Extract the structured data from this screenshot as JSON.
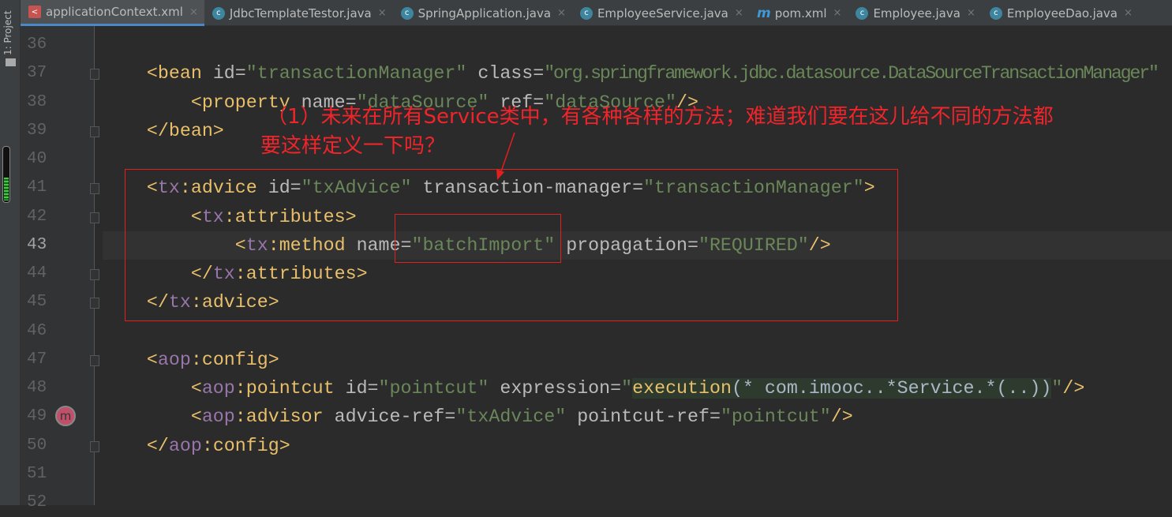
{
  "sidebar": {
    "project_label": "1: Project"
  },
  "tabs": [
    {
      "label": "applicationContext.xml",
      "icon": "xml-file-icon",
      "active": true
    },
    {
      "label": "JdbcTemplateTestor.java",
      "icon": "java-class-icon"
    },
    {
      "label": "SpringApplication.java",
      "icon": "java-class-icon"
    },
    {
      "label": "EmployeeService.java",
      "icon": "java-class-icon"
    },
    {
      "label": "pom.xml",
      "icon": "maven-icon"
    },
    {
      "label": "Employee.java",
      "icon": "java-class-icon"
    },
    {
      "label": "EmployeeDao.java",
      "icon": "java-class-icon"
    }
  ],
  "editor": {
    "current_line": "43",
    "lines": [
      {
        "n": "36",
        "tokens": []
      },
      {
        "n": "37",
        "tokens": [
          [
            "    ",
            "p"
          ],
          [
            "<bean ",
            "t"
          ],
          [
            "id=",
            "a"
          ],
          [
            "\"transactionManager\" ",
            "v"
          ],
          [
            "class=",
            "a"
          ],
          [
            "\"org.springframework.jdbc.datasource.DataSourceTransactionManager\"",
            "v"
          ]
        ]
      },
      {
        "n": "38",
        "tokens": [
          [
            "        ",
            "p"
          ],
          [
            "<property ",
            "t"
          ],
          [
            "name=",
            "a"
          ],
          [
            "\"dataSource\" ",
            "v"
          ],
          [
            "ref=",
            "a"
          ],
          [
            "\"dataSource\"",
            "v"
          ],
          [
            "/>",
            "t"
          ]
        ]
      },
      {
        "n": "39",
        "tokens": [
          [
            "    ",
            "p"
          ],
          [
            "</bean>",
            "t"
          ]
        ]
      },
      {
        "n": "40",
        "tokens": []
      },
      {
        "n": "41",
        "tokens": [
          [
            "    ",
            "p"
          ],
          [
            "<",
            "t"
          ],
          [
            "tx",
            "ns"
          ],
          [
            ":advice ",
            "t"
          ],
          [
            "id=",
            "a"
          ],
          [
            "\"txAdvice\" ",
            "v"
          ],
          [
            "transaction-manager=",
            "a"
          ],
          [
            "\"transactionManager\"",
            "v"
          ],
          [
            ">",
            "t"
          ]
        ]
      },
      {
        "n": "42",
        "tokens": [
          [
            "        ",
            "p"
          ],
          [
            "<",
            "t"
          ],
          [
            "tx",
            "ns"
          ],
          [
            ":attributes>",
            "t"
          ]
        ]
      },
      {
        "n": "43",
        "tokens": [
          [
            "            ",
            "p"
          ],
          [
            "<",
            "t"
          ],
          [
            "tx",
            "ns"
          ],
          [
            ":method ",
            "t"
          ],
          [
            "name=",
            "a"
          ],
          [
            "\"batchImport\" ",
            "v"
          ],
          [
            "propagation=",
            "a"
          ],
          [
            "\"REQUIRED\"",
            "v"
          ],
          [
            "/>",
            "t"
          ]
        ]
      },
      {
        "n": "44",
        "tokens": [
          [
            "        ",
            "p"
          ],
          [
            "</",
            "t"
          ],
          [
            "tx",
            "ns"
          ],
          [
            ":attributes>",
            "t"
          ]
        ]
      },
      {
        "n": "45",
        "tokens": [
          [
            "    ",
            "p"
          ],
          [
            "</",
            "t"
          ],
          [
            "tx",
            "ns"
          ],
          [
            ":advice>",
            "t"
          ]
        ]
      },
      {
        "n": "46",
        "tokens": []
      },
      {
        "n": "47",
        "tokens": [
          [
            "    ",
            "p"
          ],
          [
            "<",
            "t"
          ],
          [
            "aop",
            "ns"
          ],
          [
            ":config>",
            "t"
          ]
        ]
      },
      {
        "n": "48",
        "tokens": [
          [
            "        ",
            "p"
          ],
          [
            "<",
            "t"
          ],
          [
            "aop",
            "ns"
          ],
          [
            ":pointcut ",
            "t"
          ],
          [
            "id=",
            "a"
          ],
          [
            "\"pointcut\" ",
            "v"
          ],
          [
            "expression=",
            "a"
          ],
          [
            "\"",
            "v"
          ],
          [
            "execution",
            "t inj"
          ],
          [
            "(* com.imooc..*Service.*(..))",
            "p inj"
          ],
          [
            "\"",
            "v"
          ],
          [
            "/>",
            "t"
          ]
        ]
      },
      {
        "n": "49",
        "tokens": [
          [
            "        ",
            "p"
          ],
          [
            "<",
            "t"
          ],
          [
            "aop",
            "ns"
          ],
          [
            ":advisor ",
            "t"
          ],
          [
            "advice-ref=",
            "a"
          ],
          [
            "\"txAdvice\" ",
            "v"
          ],
          [
            "pointcut-ref=",
            "a"
          ],
          [
            "\"pointcut\"",
            "v"
          ],
          [
            "/>",
            "t"
          ]
        ]
      },
      {
        "n": "50",
        "tokens": [
          [
            "    ",
            "p"
          ],
          [
            "</",
            "t"
          ],
          [
            "aop",
            "ns"
          ],
          [
            ":config>",
            "t"
          ]
        ]
      },
      {
        "n": "51",
        "tokens": []
      },
      {
        "n": "52",
        "tokens": []
      }
    ]
  },
  "annotation": {
    "line1": "（1）未来在所有Service类中，有各种各样的方法；难道我们要在这儿给不同的方法都",
    "line2": "要这样定义一下吗？",
    "color": "#e02020"
  },
  "gutter_marker": "m"
}
